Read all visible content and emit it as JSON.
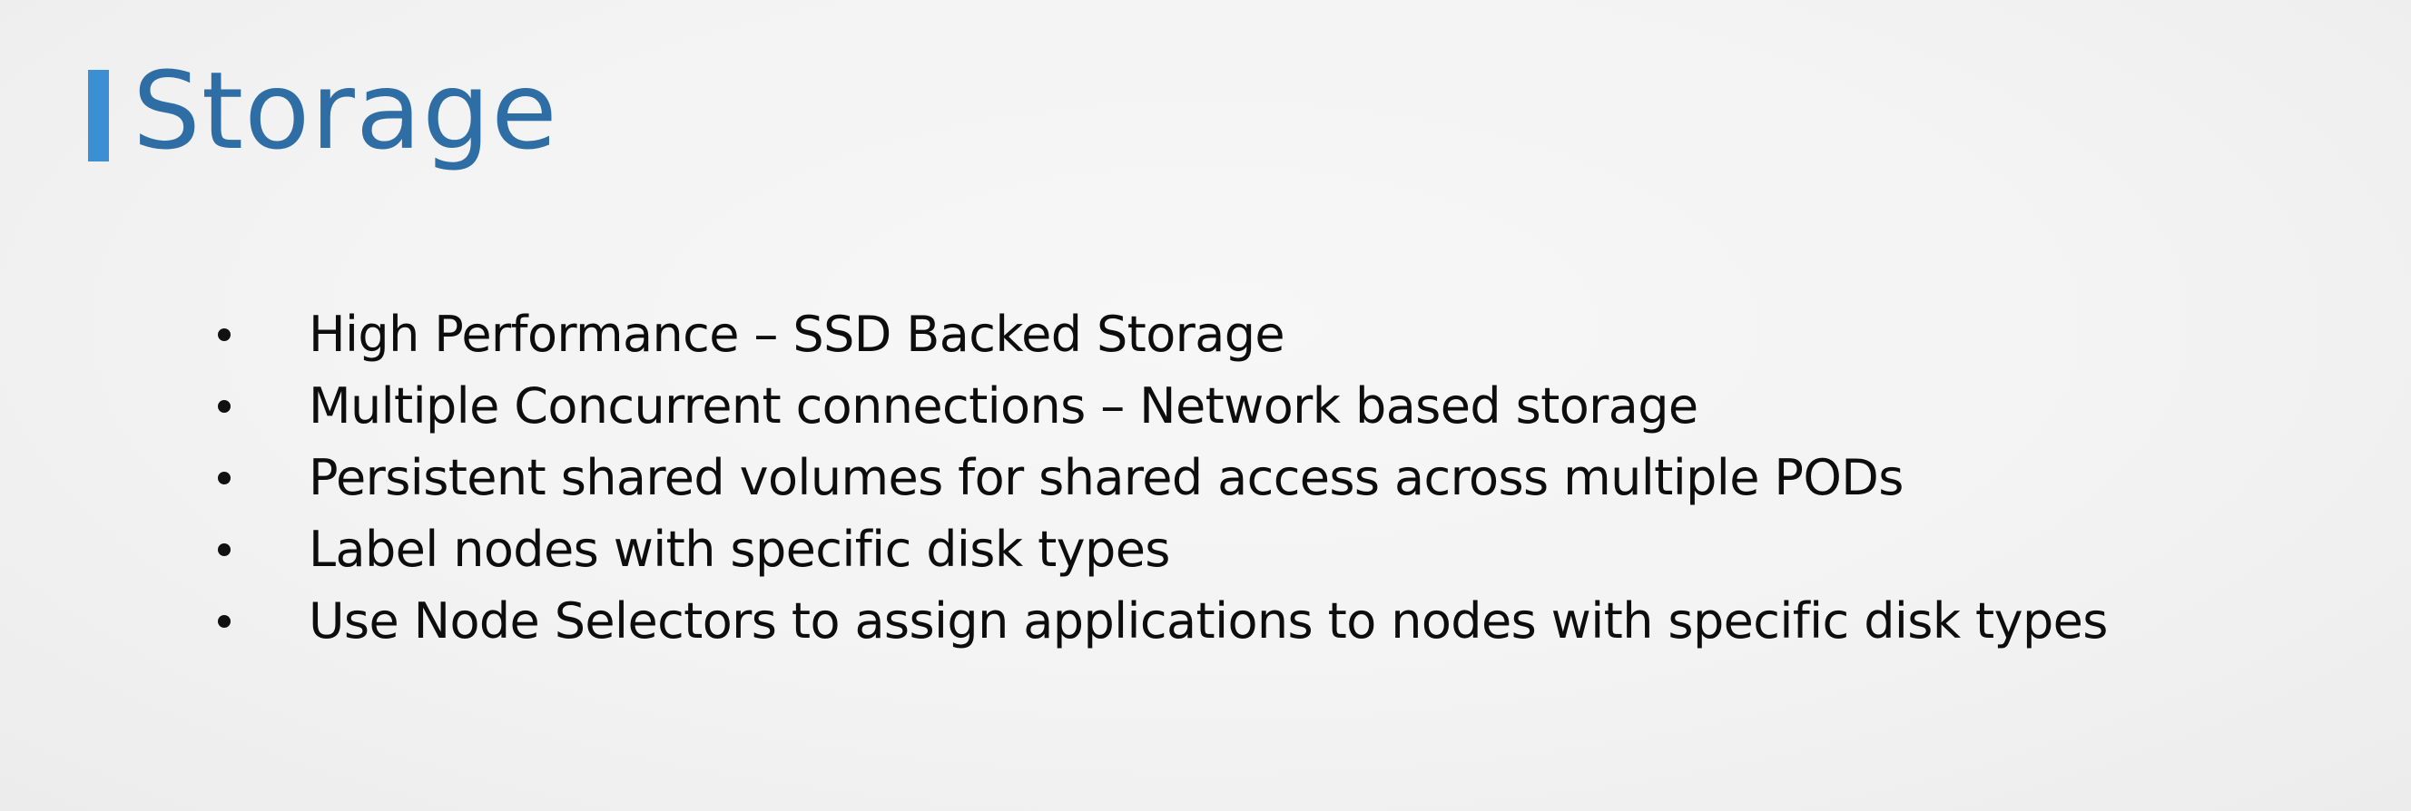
{
  "slide": {
    "title": "Storage",
    "bullets": [
      "High Performance – SSD Backed Storage",
      "Multiple Concurrent connections – Network based storage",
      "Persistent shared volumes for shared access across multiple PODs",
      "Label nodes with specific disk types",
      "Use Node Selectors to assign applications to nodes with specific disk types"
    ]
  },
  "colors": {
    "accent": "#3b8fd3",
    "title": "#2f6ea5",
    "text": "#0d0d0d",
    "background": "#f3f3f3"
  }
}
